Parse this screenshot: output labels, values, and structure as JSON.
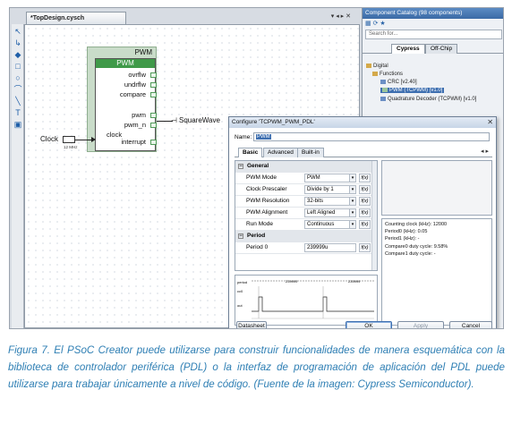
{
  "schematic": {
    "tab_title": "*TopDesign.cysch",
    "window_controls": "▾ ◂ ▸ ✕",
    "tools": [
      "↖",
      "↳",
      "◆",
      "□",
      "○",
      "⌒",
      "╲",
      "T",
      "▣"
    ],
    "pwm_component": {
      "outer_label": "PWM",
      "inner_label": "PWM",
      "pins_right": [
        "ovrflw",
        "undrflw",
        "compare",
        "pwm",
        "pwm_n",
        "interrupt"
      ],
      "pin_left": "clock"
    },
    "clock_label": "Clock",
    "clock_freq": "12 MHz",
    "output_label": "SquareWave"
  },
  "catalog": {
    "title": "Component Catalog (98 components)",
    "search_placeholder": "Search for...",
    "tabs": [
      "Cypress",
      "Off-Chip"
    ],
    "tree": [
      "Digital",
      "Functions",
      "CRC [v2.40]",
      "PWM (TCPWM) [v1.0]",
      "Quadrature Decoder (TCPWM) [v1.0]"
    ]
  },
  "dialog": {
    "title": "Configure 'TCPWM_PWM_PDL'",
    "close": "✕",
    "name_label": "Name:",
    "name_value": "PWM",
    "tabs": [
      "Basic",
      "Advanced",
      "Built-in"
    ],
    "tab_nav": "◂ ▸",
    "sections": [
      {
        "name": "General",
        "rows": [
          {
            "name": "PWM Mode",
            "value": "PWM",
            "fx": "f(x)"
          },
          {
            "name": "Clock Prescaler",
            "value": "Divide by 1",
            "fx": "f(x)"
          },
          {
            "name": "PWM Resolution",
            "value": "32-bits",
            "fx": "f(x)"
          },
          {
            "name": "PWM Alignment",
            "value": "Left Aligned",
            "fx": "f(x)"
          },
          {
            "name": "Run Mode",
            "value": "Continuous",
            "fx": "f(x)"
          }
        ]
      },
      {
        "name": "Period",
        "rows": [
          {
            "name": "Period 0",
            "value": "239999u",
            "fx": "f(x)"
          }
        ]
      }
    ],
    "info_lines": [
      "Counting clock (kHz): 12000",
      "Period0 (kHz):          0.05",
      "Period1 (kHz):          -",
      "Compare0 duty cycle: 9.58%",
      "Compare1 duty cycle: -"
    ],
    "waveform_labels": [
      "period",
      "cc0",
      "out"
    ],
    "waveform_value": "239999",
    "buttons": {
      "datasheet": "Datasheet",
      "ok": "OK",
      "apply": "Apply",
      "cancel": "Cancel"
    }
  },
  "caption": "Figura 7. El PSoC Creator puede utilizarse para construir funcionalidades de manera esquemática con la biblioteca de controlador periférica (PDL) o la interfaz de programación de aplicación del PDL puede utilizarse para trabajar únicamente a nivel de código. (Fuente de la imagen: Cypress Semiconductor)."
}
